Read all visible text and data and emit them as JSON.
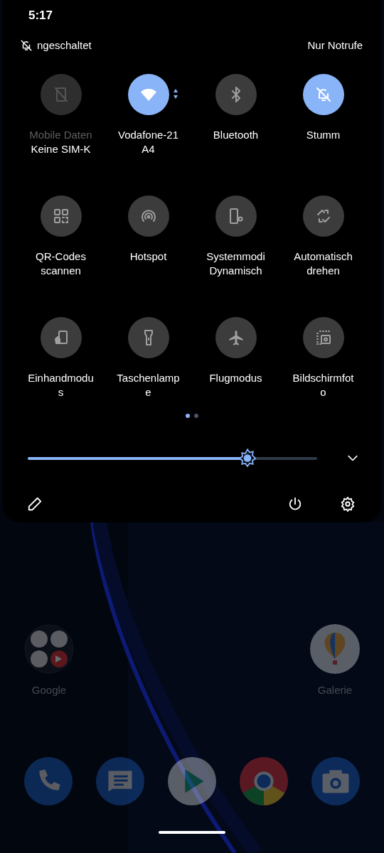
{
  "status_bar": {
    "time": "5:17"
  },
  "header": {
    "ringer_text": "ngeschaltet",
    "network_text": "Nur Notrufe"
  },
  "tiles": [
    {
      "lines": [
        "Mobile Daten"
      ],
      "subtitle": "Keine SIM-K",
      "on": false,
      "disabled": true
    },
    {
      "lines": [
        "Vodafone-21",
        "A4"
      ],
      "on": true,
      "disabled": false,
      "activity": true
    },
    {
      "lines": [
        "Bluetooth"
      ],
      "on": false,
      "disabled": false
    },
    {
      "lines": [
        "Stumm"
      ],
      "on": true,
      "disabled": false
    },
    {
      "lines": [
        "QR-Codes",
        "scannen"
      ],
      "on": false,
      "disabled": false
    },
    {
      "lines": [
        "Hotspot"
      ],
      "on": false,
      "disabled": false
    },
    {
      "lines": [
        "Systemmodi",
        "Dynamisch"
      ],
      "on": false,
      "disabled": false
    },
    {
      "lines": [
        "Automatisch",
        "drehen"
      ],
      "on": false,
      "disabled": false
    },
    {
      "lines": [
        "Einhandmodu",
        "s"
      ],
      "on": false,
      "disabled": false
    },
    {
      "lines": [
        "Taschenlamp",
        "e"
      ],
      "on": false,
      "disabled": false
    },
    {
      "lines": [
        "Flugmodus"
      ],
      "on": false,
      "disabled": false
    },
    {
      "lines": [
        "Bildschirmfot",
        "o"
      ],
      "on": false,
      "disabled": false
    }
  ],
  "pages": [
    {
      "selected": true
    },
    {
      "selected": false
    }
  ],
  "brightness": {
    "level": 0.76
  },
  "home": {
    "apps": [
      {
        "label": "Google"
      },
      {
        "label": "Galerie"
      }
    ]
  }
}
